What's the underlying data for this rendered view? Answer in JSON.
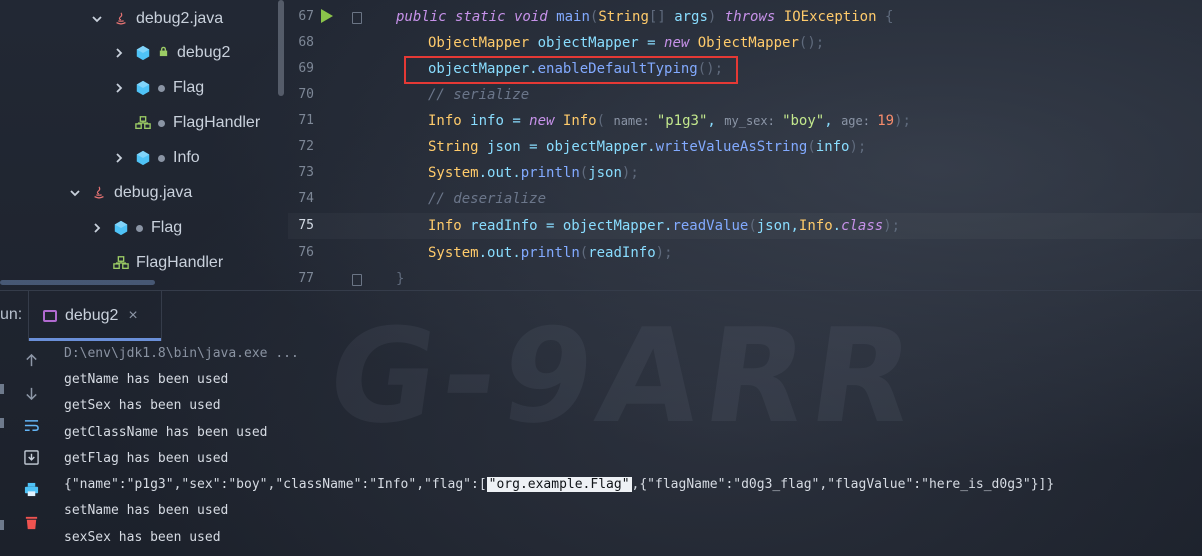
{
  "tree": {
    "items": [
      {
        "label": "debug2.java",
        "kind": "java-file",
        "expanded": true
      },
      {
        "label": "debug2",
        "kind": "class-lock"
      },
      {
        "label": "Flag",
        "kind": "class"
      },
      {
        "label": "FlagHandler",
        "kind": "handler"
      },
      {
        "label": "Info",
        "kind": "class"
      },
      {
        "label": "debug.java",
        "kind": "java-file",
        "expanded": true
      },
      {
        "label": "Flag",
        "kind": "class"
      },
      {
        "label": "FlagHandler",
        "kind": "handler"
      }
    ]
  },
  "editor": {
    "line_numbers": [
      "67",
      "68",
      "69",
      "70",
      "71",
      "72",
      "73",
      "74",
      "75",
      "76",
      "77"
    ],
    "current_line": "75",
    "lines": [
      {
        "tokens": [
          [
            "kw",
            "public static void "
          ],
          [
            "fn",
            "main"
          ],
          [
            "br",
            "("
          ],
          [
            "ty",
            "String"
          ],
          [
            "br",
            "[] "
          ],
          [
            "pl",
            "args"
          ],
          [
            "br",
            ") "
          ],
          [
            "kw",
            "throws "
          ],
          [
            "ty",
            "IOException "
          ],
          [
            "br",
            "{"
          ]
        ]
      },
      {
        "tokens": [
          [
            "ty",
            "ObjectMapper "
          ],
          [
            "pl",
            "objectMapper "
          ],
          [
            "pl",
            "= "
          ],
          [
            "kw",
            "new "
          ],
          [
            "ty",
            "ObjectMapper"
          ],
          [
            "br",
            "();"
          ]
        ]
      },
      {
        "tokens": [
          [
            "pl",
            "objectMapper"
          ],
          [
            "pl",
            "."
          ],
          [
            "fn",
            "enableDefaultTyping"
          ],
          [
            "br",
            "();"
          ]
        ]
      },
      {
        "tokens": [
          [
            "cm",
            "// serialize"
          ]
        ]
      },
      {
        "tokens": [
          [
            "ty",
            "Info "
          ],
          [
            "pl",
            "info "
          ],
          [
            "pl",
            "= "
          ],
          [
            "kw",
            "new "
          ],
          [
            "ty",
            "Info"
          ],
          [
            "br",
            "( "
          ],
          [
            "hint",
            "name: "
          ],
          [
            "st",
            "\"p1g3\""
          ],
          [
            "pl",
            ", "
          ],
          [
            "hint",
            "my_sex: "
          ],
          [
            "st",
            "\"boy\""
          ],
          [
            "pl",
            ", "
          ],
          [
            "hint",
            "age: "
          ],
          [
            "nu",
            "19"
          ],
          [
            "br",
            ");"
          ]
        ]
      },
      {
        "tokens": [
          [
            "ty",
            "String "
          ],
          [
            "pl",
            "json "
          ],
          [
            "pl",
            "= "
          ],
          [
            "pl",
            "objectMapper."
          ],
          [
            "fn",
            "writeValueAsString"
          ],
          [
            "br",
            "("
          ],
          [
            "pl",
            "info"
          ],
          [
            "br",
            ");"
          ]
        ]
      },
      {
        "tokens": [
          [
            "ty",
            "System"
          ],
          [
            "pl",
            "."
          ],
          [
            "pl",
            "out"
          ],
          [
            "pl",
            "."
          ],
          [
            "fn",
            "println"
          ],
          [
            "br",
            "("
          ],
          [
            "pl",
            "json"
          ],
          [
            "br",
            ");"
          ]
        ]
      },
      {
        "tokens": [
          [
            "cm",
            "// deserialize"
          ]
        ]
      },
      {
        "tokens": [
          [
            "ty",
            "Info "
          ],
          [
            "pl",
            "readInfo "
          ],
          [
            "pl",
            "= "
          ],
          [
            "pl",
            "objectMapper."
          ],
          [
            "fn",
            "readValue"
          ],
          [
            "br",
            "("
          ],
          [
            "pl",
            "json,"
          ],
          [
            "ty",
            "Info"
          ],
          [
            "pl",
            "."
          ],
          [
            "kw",
            "class"
          ],
          [
            "br",
            ");"
          ]
        ]
      },
      {
        "tokens": [
          [
            "ty",
            "System"
          ],
          [
            "pl",
            "."
          ],
          [
            "pl",
            "out"
          ],
          [
            "pl",
            "."
          ],
          [
            "fn",
            "println"
          ],
          [
            "br",
            "("
          ],
          [
            "pl",
            "readInfo"
          ],
          [
            "br",
            ");"
          ]
        ]
      },
      {
        "tokens": [
          [
            "br",
            "}"
          ]
        ]
      }
    ],
    "highlight_color": "#e53935"
  },
  "run": {
    "label": "un:",
    "tab_label": "debug2",
    "close_glyph": "×"
  },
  "toolbar": {
    "icons": [
      "arrow-up-icon",
      "arrow-down-icon",
      "soft-wrap-icon",
      "scroll-to-end-icon",
      "print-icon",
      "trash-icon"
    ]
  },
  "console": {
    "cmd": "D:\\env\\jdk1.8\\bin\\java.exe ...",
    "lines": [
      "getName has been used",
      "getSex has been used",
      "getClassName has been used",
      "getFlag has been used"
    ],
    "json_prefix": "{\"name\":\"p1g3\",\"sex\":\"boy\",\"className\":\"Info\",\"flag\":[",
    "json_selected": "\"org.example.Flag\"",
    "json_suffix": ",{\"flagName\":\"d0g3_flag\",\"flagValue\":\"here_is_d0g3\"}]}",
    "lines_after": [
      "setName has been used",
      "sexSex has been used"
    ]
  },
  "colors": {
    "run_arrow": "#8bc34a",
    "tab_underline": "#6a8fd8",
    "class_icon": "#4fc3f7",
    "handler_icon": "#9ccc65",
    "java_icon": "#e57373"
  }
}
